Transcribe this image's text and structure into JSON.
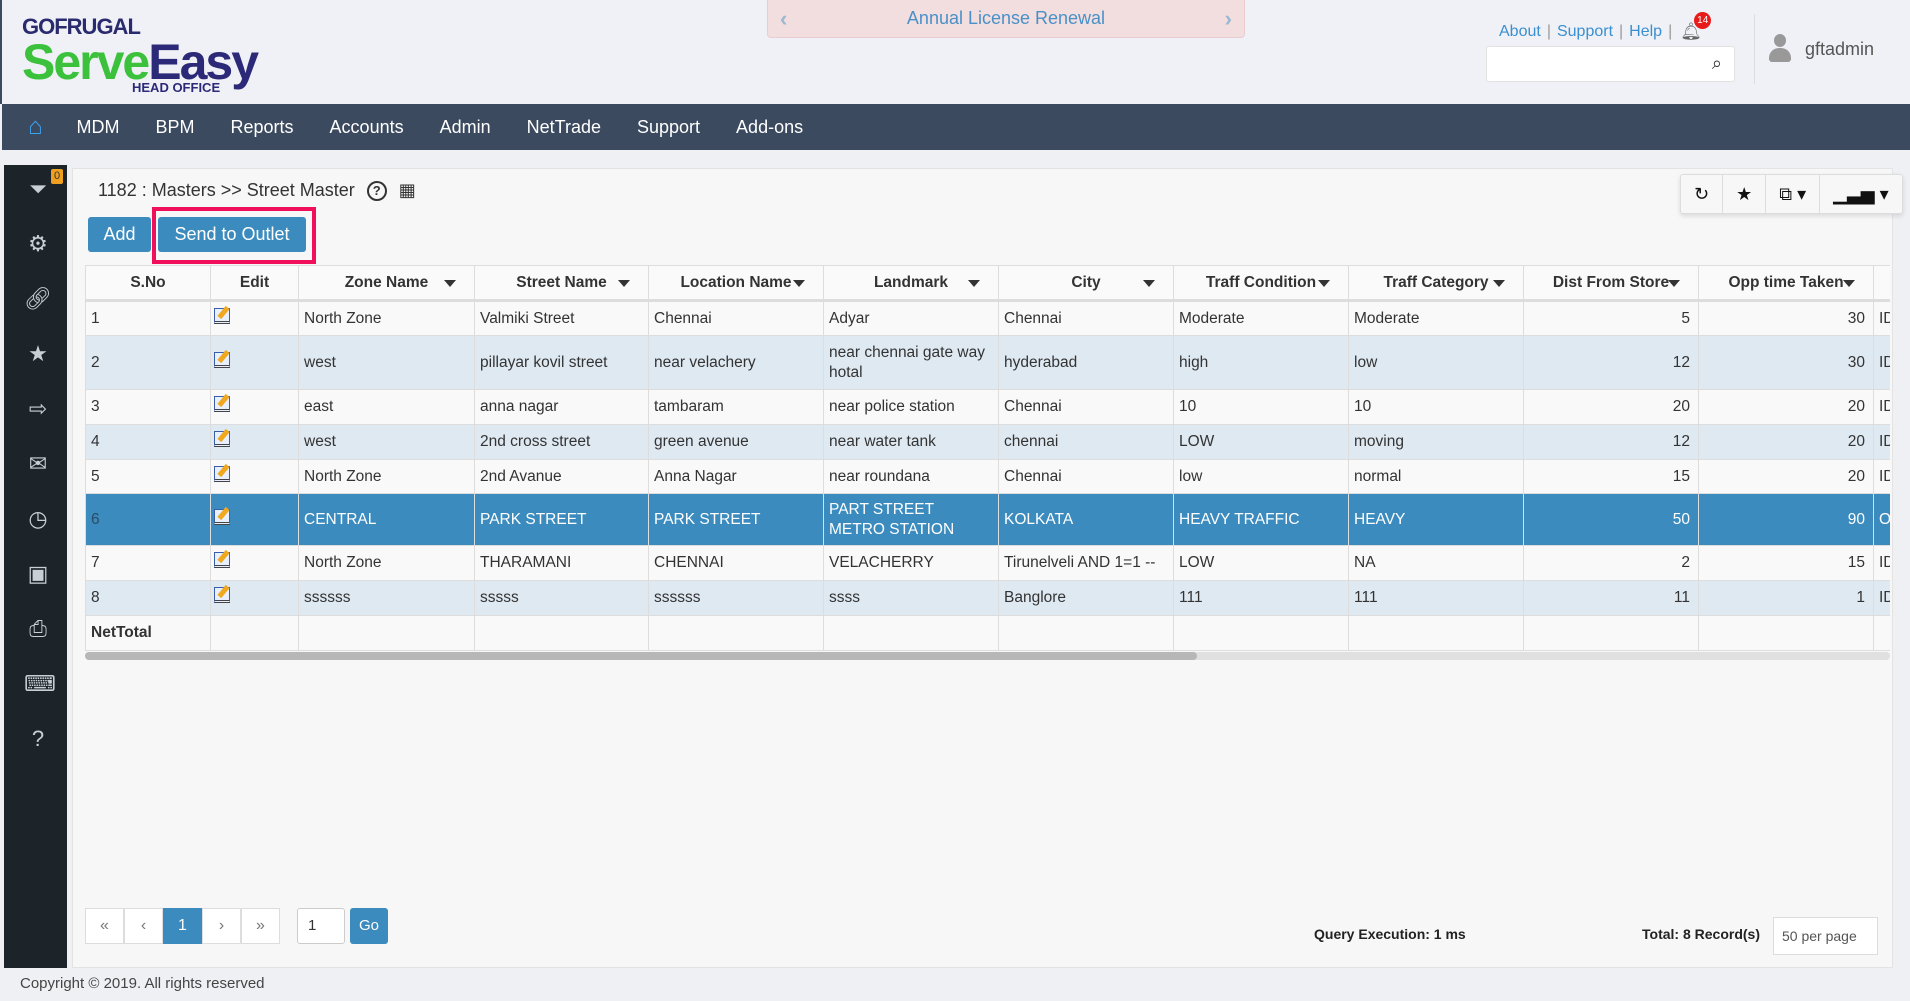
{
  "header": {
    "logo_top": "GOFRUGAL",
    "logo_serve": "Serve",
    "logo_easy": "Easy",
    "logo_sub": "HEAD OFFICE",
    "banner": "Annual License Renewal",
    "links": [
      "About",
      "Support",
      "Help"
    ],
    "notification_count": "14",
    "username": "gftadmin"
  },
  "nav": [
    "MDM",
    "BPM",
    "Reports",
    "Accounts",
    "Admin",
    "NetTrade",
    "Support",
    "Add-ons"
  ],
  "sidebar": {
    "filter_count": "0"
  },
  "page": {
    "breadcrumb": "1182 : Masters >> Street Master",
    "add": "Add",
    "send": "Send to Outlet"
  },
  "table": {
    "headers": [
      "S.No",
      "Edit",
      "Zone Name",
      "Street Name",
      "Location Name",
      "Landmark",
      "City",
      "Traff Condition",
      "Traff Category",
      "Dist From Store",
      "Opp time Taken",
      ""
    ],
    "rows": [
      [
        "1",
        "",
        "North Zone",
        "Valmiki Street",
        "Chennai",
        "Adyar",
        "Chennai",
        "Moderate",
        "Moderate",
        "5",
        "30",
        "ID"
      ],
      [
        "2",
        "",
        "west",
        "pillayar kovil street",
        "near velachery",
        "near chennai gate way hotal",
        "hyderabad",
        "high",
        "low",
        "12",
        "30",
        "ID"
      ],
      [
        "3",
        "",
        "east",
        "anna nagar",
        "tambaram",
        "near police station",
        "Chennai",
        "10",
        "10",
        "20",
        "20",
        "ID"
      ],
      [
        "4",
        "",
        "west",
        "2nd cross street",
        "green avenue",
        "near water tank",
        "chennai",
        "LOW",
        "moving",
        "12",
        "20",
        "ID"
      ],
      [
        "5",
        "",
        "North Zone",
        "2nd Avanue",
        "Anna Nagar",
        "near roundana",
        "Chennai",
        "low",
        "normal",
        "15",
        "20",
        "ID"
      ],
      [
        "6",
        "",
        "CENTRAL",
        "PARK STREET",
        "PARK STREET",
        "PART STREET METRO STATION",
        "KOLKATA",
        "HEAVY TRAFFIC",
        "HEAVY",
        "50",
        "90",
        "O"
      ],
      [
        "7",
        "",
        "North Zone",
        "THARAMANI",
        "CHENNAI",
        "VELACHERRY",
        "Tirunelveli AND 1=1 --",
        "LOW",
        "NA",
        "2",
        "15",
        "ID"
      ],
      [
        "8",
        "",
        "ssssss",
        "sssss",
        "ssssss",
        "ssss",
        "Banglore",
        "111",
        "111",
        "11",
        "1",
        "ID"
      ]
    ],
    "footer": "NetTotal"
  },
  "pager": {
    "first": "«",
    "prev": "‹",
    "current": "1",
    "next": "›",
    "last": "»",
    "page_input": "1",
    "go": "Go",
    "query": "Query Execution: 1 ms",
    "total": "Total: 8 Record(s)",
    "per_page": "50 per page"
  },
  "copyright": "Copyright © 2019. All rights reserved"
}
